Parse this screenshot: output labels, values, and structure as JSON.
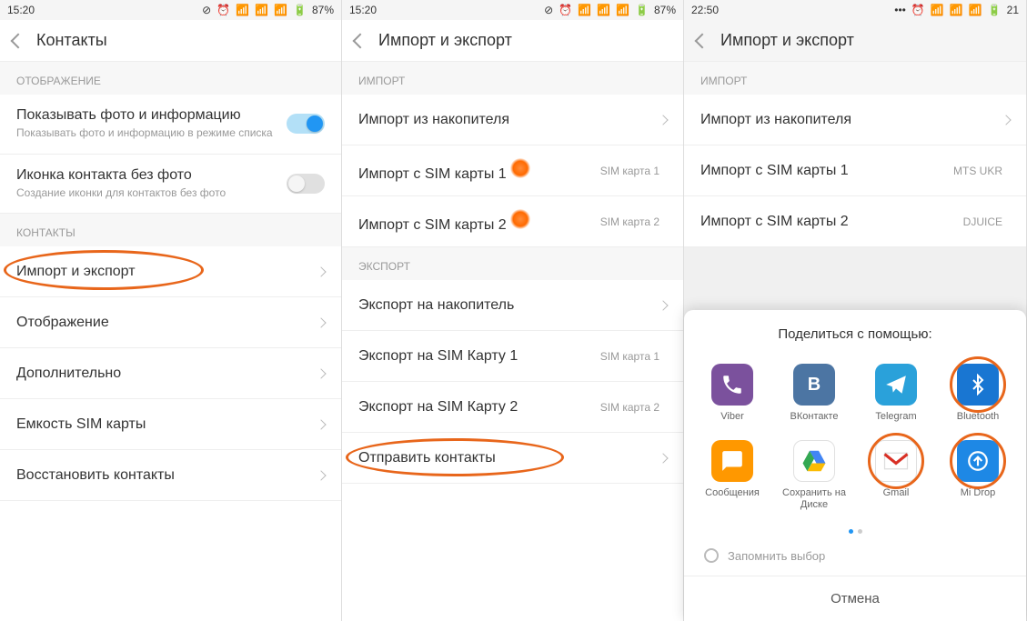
{
  "status": {
    "time1": "15:20",
    "time2": "15:20",
    "time3": "22:50",
    "battery12": "87%",
    "battery3": "21"
  },
  "s1": {
    "title": "Контакты",
    "sec_display": "ОТОБРАЖЕНИЕ",
    "show_photo_title": "Показывать фото и информацию",
    "show_photo_sub": "Показывать фото и информацию в режиме списка",
    "icon_nophoto_title": "Иконка контакта без фото",
    "icon_nophoto_sub": "Создание иконки для контактов без фото",
    "sec_contacts": "КОНТАКТЫ",
    "r1": "Импорт и экспорт",
    "r2": "Отображение",
    "r3": "Дополнительно",
    "r4": "Емкость SIM карты",
    "r5": "Восстановить контакты"
  },
  "s2": {
    "title": "Импорт и экспорт",
    "sec_import": "ИМПОРТ",
    "imp_storage": "Импорт из накопителя",
    "imp_sim1": "Импорт с SIM карты 1",
    "imp_sim1_right": "SIM карта 1",
    "imp_sim2": "Импорт с SIM карты 2",
    "imp_sim2_right": "SIM карта 2",
    "sec_export": "ЭКСПОРТ",
    "exp_storage": "Экспорт на накопитель",
    "exp_sim1": "Экспорт на SIM Карту 1",
    "exp_sim1_right": "SIM карта 1",
    "exp_sim2": "Экспорт на SIM Карту 2",
    "exp_sim2_right": "SIM карта 2",
    "send": "Отправить контакты"
  },
  "s3": {
    "title": "Импорт и экспорт",
    "sec_import": "ИМПОРТ",
    "imp_storage": "Импорт из накопителя",
    "imp_sim1": "Импорт с SIM карты 1",
    "imp_sim1_right": "MTS UKR",
    "imp_sim2": "Импорт с SIM карты 2",
    "imp_sim2_right": "DJUICE",
    "sheet_title": "Поделиться с помощью:",
    "apps": [
      {
        "label": "Viber",
        "bg": "#7b519d",
        "fg": "#fff",
        "glyph": "phone"
      },
      {
        "label": "ВКонтакте",
        "bg": "#4c75a3",
        "fg": "#fff",
        "glyph": "vk"
      },
      {
        "label": "Telegram",
        "bg": "#2aa1da",
        "fg": "#fff",
        "glyph": "paper"
      },
      {
        "label": "Bluetooth",
        "bg": "#1976d2",
        "fg": "#fff",
        "glyph": "bt",
        "circled": true
      },
      {
        "label": "Сообщения",
        "bg": "#ff9800",
        "fg": "#fff",
        "glyph": "msg"
      },
      {
        "label": "Сохранить на Диске",
        "bg": "#ffffff",
        "fg": "#fff",
        "glyph": "drive"
      },
      {
        "label": "Gmail",
        "bg": "#ffffff",
        "fg": "#d93025",
        "glyph": "gmail",
        "circled": true
      },
      {
        "label": "Mi Drop",
        "bg": "#1e88e5",
        "fg": "#fff",
        "glyph": "midrop",
        "circled": true
      }
    ],
    "remember": "Запомнить выбор",
    "cancel": "Отмена"
  }
}
